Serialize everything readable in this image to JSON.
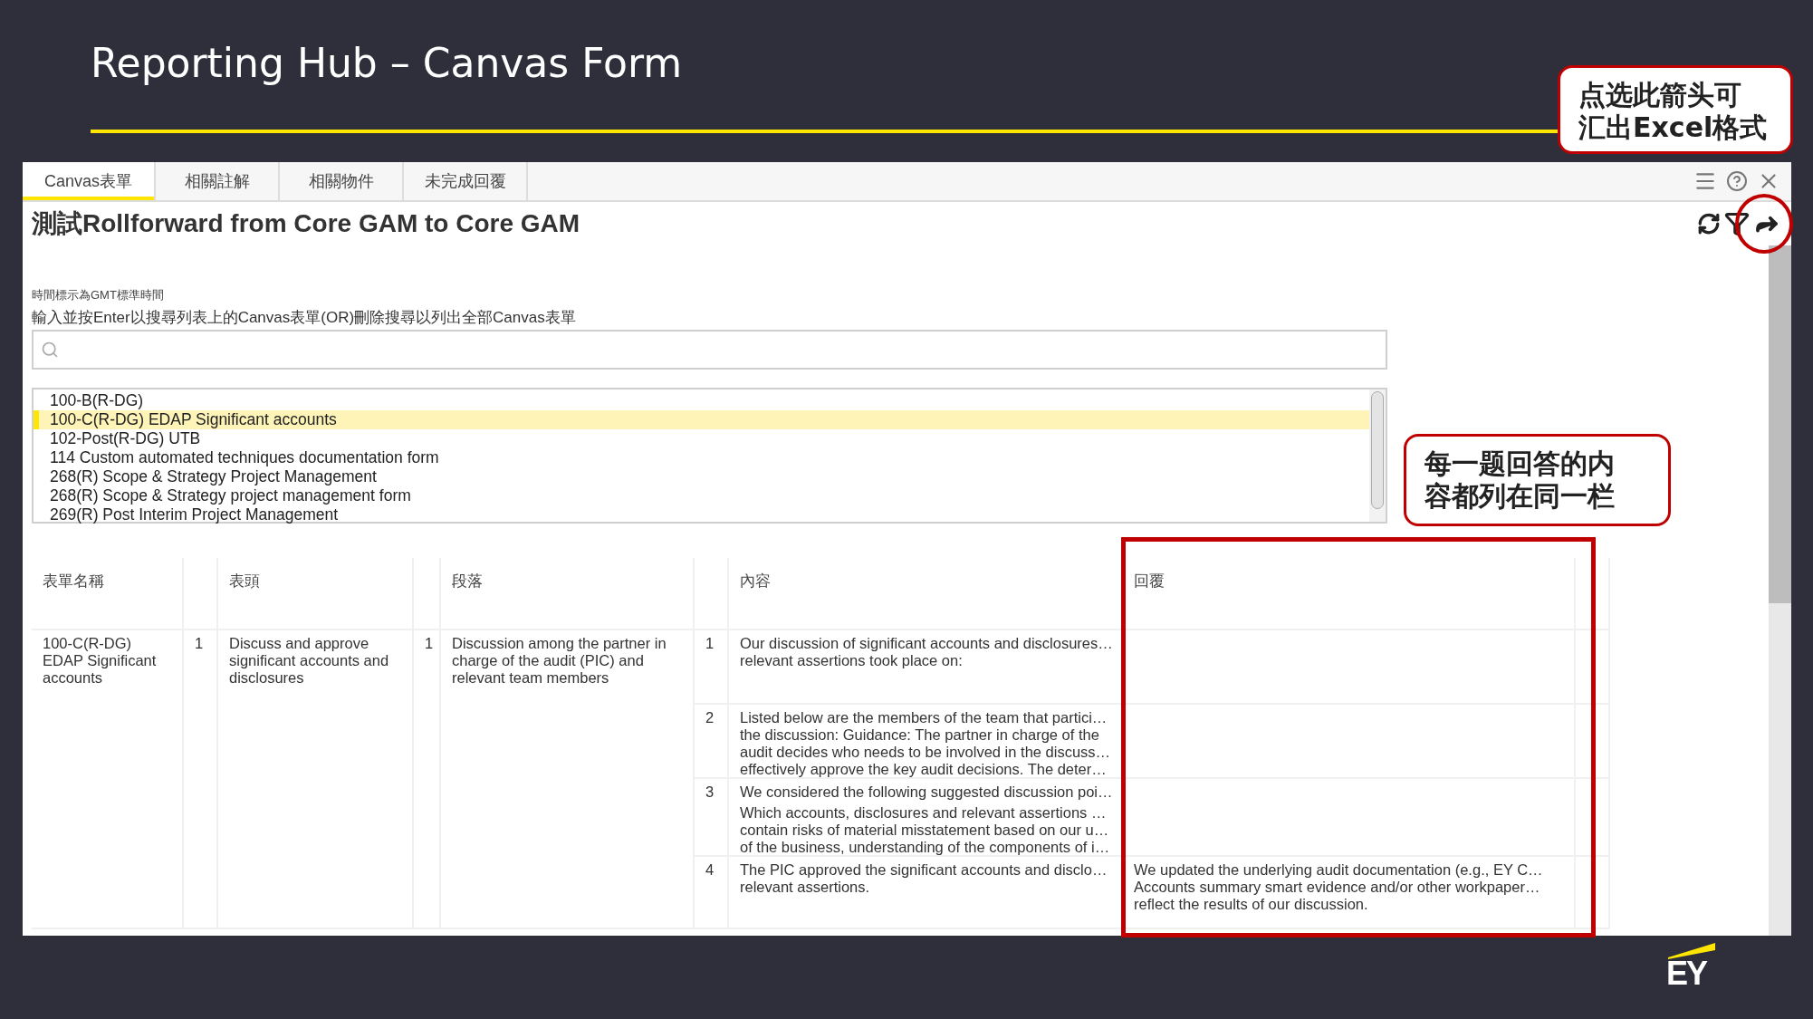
{
  "slide": {
    "title": "Reporting Hub – Canvas Form",
    "logo_text": "EY"
  },
  "tabs": [
    {
      "label": "Canvas表單",
      "selected": true
    },
    {
      "label": "相關註解",
      "selected": false
    },
    {
      "label": "相關物件",
      "selected": false
    },
    {
      "label": "未完成回覆",
      "selected": false
    }
  ],
  "form": {
    "title": "測試Rollforward from Core GAM to Core GAM",
    "time_note": "時間標示為GMT標準時間",
    "instruction": "輸入並按Enter以搜尋列表上的Canvas表單(OR)刪除搜尋以列出全部Canvas表單"
  },
  "list": [
    {
      "label": "100-B(R-DG)",
      "selected": false
    },
    {
      "label": "100-C(R-DG) EDAP Significant accounts",
      "selected": true
    },
    {
      "label": "102-Post(R-DG) UTB",
      "selected": false
    },
    {
      "label": "114 Custom automated techniques documentation form",
      "selected": false
    },
    {
      "label": "268(R) Scope & Strategy Project Management",
      "selected": false
    },
    {
      "label": "268(R) Scope & Strategy project management form",
      "selected": false
    },
    {
      "label": "269(R) Post Interim Project Management",
      "selected": false
    }
  ],
  "table": {
    "columns": [
      "表單名稱",
      "表頭",
      "段落",
      "內容",
      "回覆"
    ],
    "group": {
      "form_name": "100-C(R-DG)\nEDAP Significant\naccounts",
      "header_no": "1",
      "header": "Discuss and approve\nsignificant accounts and\ndisclosures",
      "paragraph_no": "1",
      "paragraph": "Discussion among the partner in\ncharge of the audit (PIC) and\nrelevant team members",
      "items": [
        {
          "no": "1",
          "content": "Our discussion of significant accounts and disclosures…\nrelevant assertions took place on:"
        },
        {
          "no": "2",
          "content": "Listed below are the members of the team that partici…\nthe discussion: Guidance: The partner in charge of the\naudit decides who needs to be involved in the discuss…\neffectively approve the key audit decisions. The deter…"
        },
        {
          "no": "3",
          "content": "We considered the following suggested discussion poi…",
          "extra": "Which accounts, disclosures and relevant assertions …\ncontain risks of material misstatement based on our u…\nof the business, understanding of the components of i…"
        },
        {
          "no": "4",
          "content": "The PIC approved the significant accounts and disclo…\nrelevant assertions.",
          "reply": "We updated the underlying audit documentation (e.g., EY C…\nAccounts summary smart evidence and/or other workpaper…\nreflect the results of our discussion."
        }
      ]
    }
  },
  "annotations": {
    "export_callout": [
      "点选此箭头可",
      "汇出Excel格式"
    ],
    "column_callout": [
      "每一题回答的内",
      "容都列在同一栏"
    ]
  }
}
